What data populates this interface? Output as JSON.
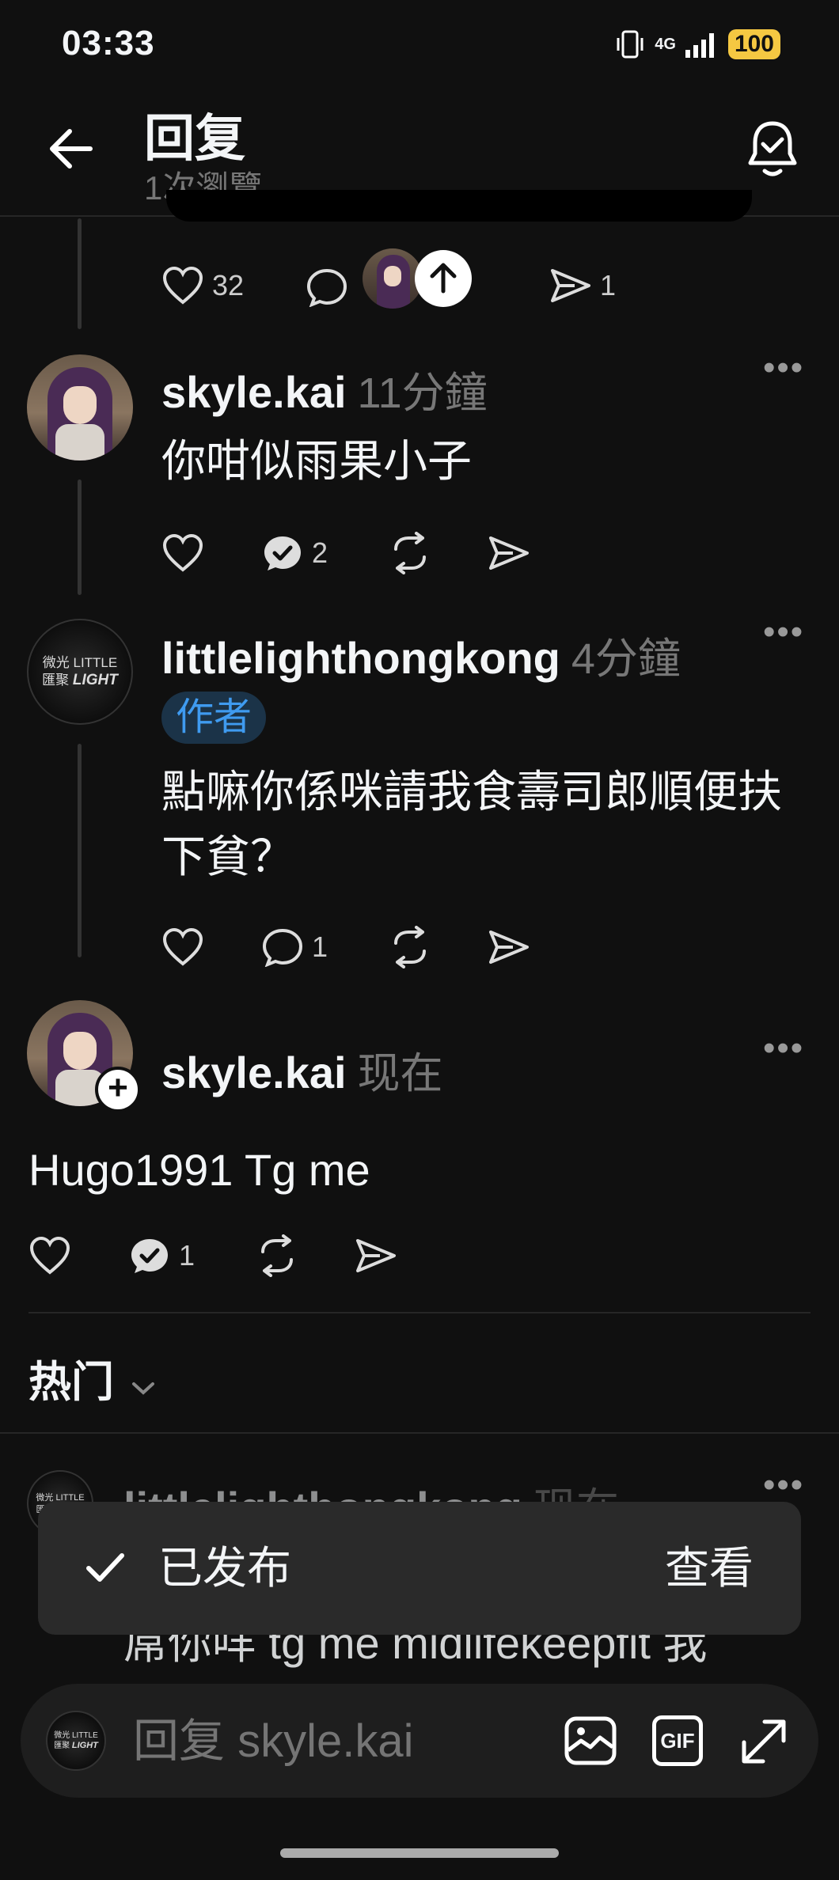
{
  "status_bar": {
    "time": "03:33",
    "network": "4G",
    "battery": "100",
    "icons": [
      "vibrate-icon",
      "signal-icon",
      "battery-icon"
    ]
  },
  "header": {
    "title": "回复",
    "subtitle": "1次瀏覽",
    "back_icon": "arrow-left-icon",
    "notify_icon": "bell-check-icon"
  },
  "top_actions": {
    "likes": "32",
    "shares": "1"
  },
  "posts": [
    {
      "username": "skyle.kai",
      "time": "11分鐘",
      "text": "你咁似雨果小子",
      "replies": "2"
    },
    {
      "username": "littlelighthongkong",
      "time": "4分鐘",
      "badge": "作者",
      "text_line1": "點嘛你係咪請我食壽司郎順便扶",
      "text_line2": "下貧？",
      "replies": "1",
      "avatar_text_cn1": "微光",
      "avatar_text_en1": "LITTLE",
      "avatar_text_cn2": "匯聚",
      "avatar_text_en2": "LIGHT"
    },
    {
      "username": "skyle.kai",
      "time": "现在",
      "text": "Hugo1991 Tg me",
      "replies": "1"
    }
  ],
  "popular": {
    "label": "热门",
    "preview_username": "littlelighthongkong",
    "preview_time": "现在",
    "preview_text": "屌你咩 tg me midlifekeepfit 我"
  },
  "toast": {
    "label": "已发布",
    "action": "查看"
  },
  "composer": {
    "placeholder": "回复 skyle.kai",
    "gif_label": "GIF"
  }
}
